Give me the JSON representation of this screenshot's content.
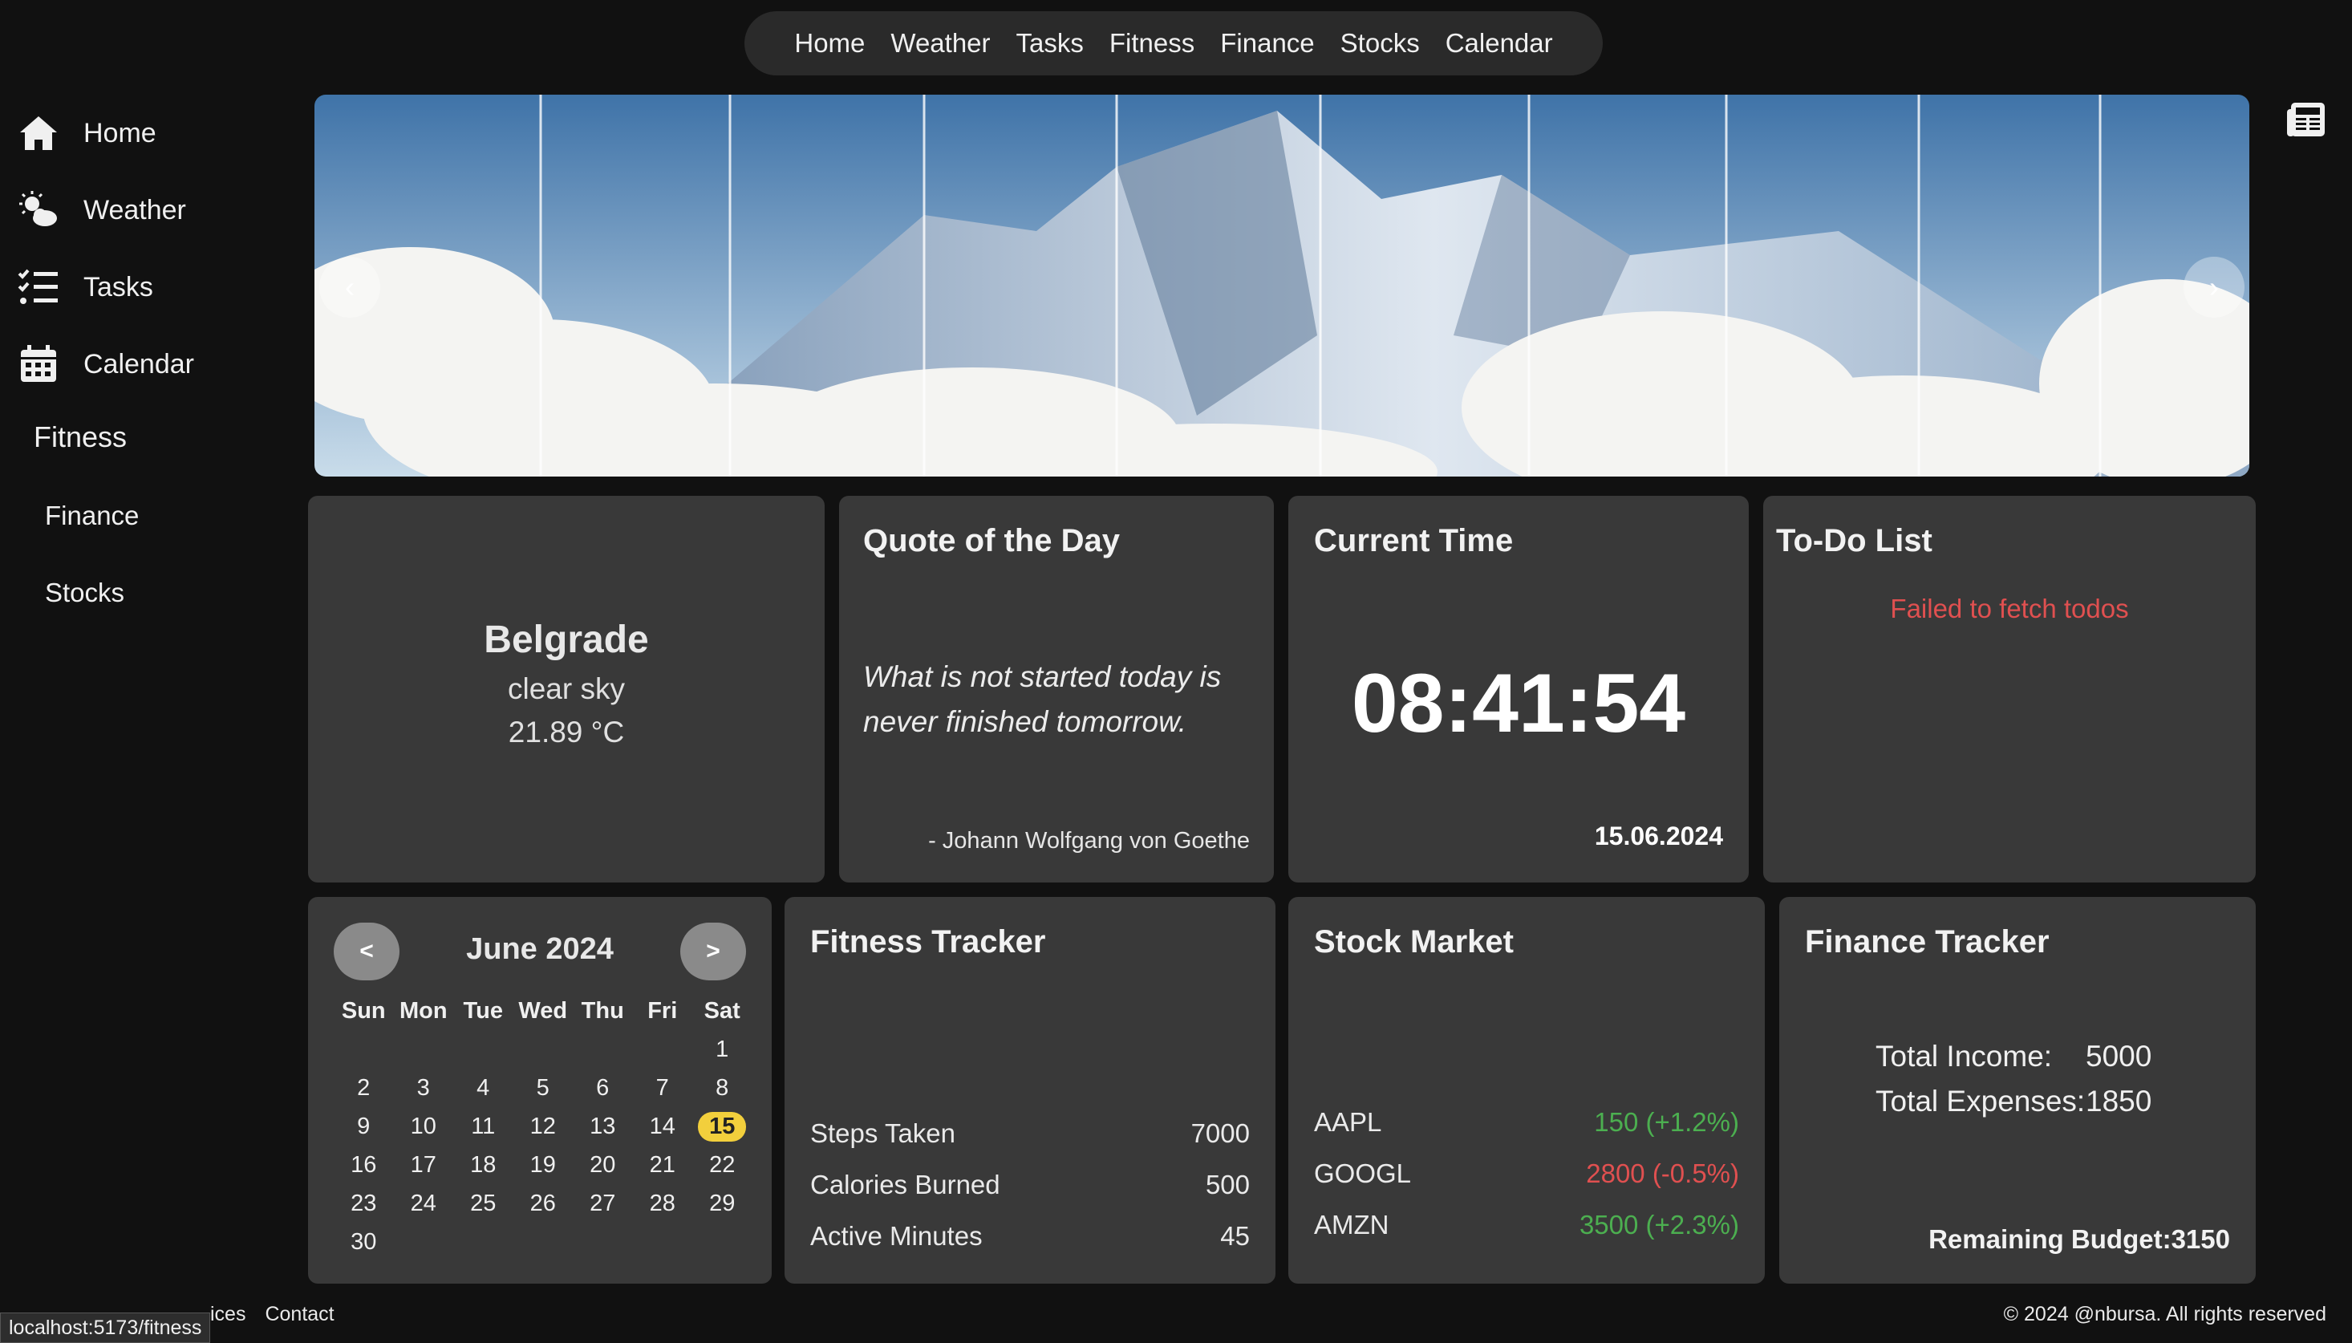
{
  "topnav": [
    "Home",
    "Weather",
    "Tasks",
    "Fitness",
    "Finance",
    "Stocks",
    "Calendar"
  ],
  "sidebar": {
    "items": [
      {
        "label": "Home",
        "icon": "home-icon"
      },
      {
        "label": "Weather",
        "icon": "weather-icon"
      },
      {
        "label": "Tasks",
        "icon": "tasks-icon"
      },
      {
        "label": "Calendar",
        "icon": "calendar-icon"
      },
      {
        "label": "Fitness"
      },
      {
        "label": "Finance"
      },
      {
        "label": "Stocks"
      }
    ]
  },
  "hero": {
    "prev": "‹",
    "next": "›"
  },
  "weather": {
    "city": "Belgrade",
    "description": "clear sky",
    "temperature": "21.89 °C"
  },
  "quote": {
    "title": "Quote of the Day",
    "text": "What is not started today is never finished tomorrow.",
    "author": "- Johann Wolfgang von Goethe"
  },
  "clock": {
    "title": "Current Time",
    "time": "08:41:54",
    "date": "15.06.2024"
  },
  "todo": {
    "title": "To-Do List",
    "error": "Failed to fetch todos"
  },
  "calendar": {
    "prev": "<",
    "next": ">",
    "title": "June 2024",
    "weekdays": [
      "Sun",
      "Mon",
      "Tue",
      "Wed",
      "Thu",
      "Fri",
      "Sat"
    ],
    "weeks": [
      [
        "",
        "",
        "",
        "",
        "",
        "",
        "1"
      ],
      [
        "2",
        "3",
        "4",
        "5",
        "6",
        "7",
        "8"
      ],
      [
        "9",
        "10",
        "11",
        "12",
        "13",
        "14",
        "15"
      ],
      [
        "16",
        "17",
        "18",
        "19",
        "20",
        "21",
        "22"
      ],
      [
        "23",
        "24",
        "25",
        "26",
        "27",
        "28",
        "29"
      ],
      [
        "30",
        "",
        "",
        "",
        "",
        "",
        ""
      ]
    ],
    "today": "15"
  },
  "fitness": {
    "title": "Fitness Tracker",
    "stats": [
      {
        "label": "Steps Taken",
        "value": "7000"
      },
      {
        "label": "Calories Burned",
        "value": "500"
      },
      {
        "label": "Active Minutes",
        "value": "45"
      }
    ]
  },
  "stocks": {
    "title": "Stock Market",
    "items": [
      {
        "symbol": "AAPL",
        "value": "150 (+1.2%)",
        "color": "#4caf50"
      },
      {
        "symbol": "GOOGL",
        "value": "2800 (-0.5%)",
        "color": "#e05050"
      },
      {
        "symbol": "AMZN",
        "value": "3500 (+2.3%)",
        "color": "#4caf50"
      }
    ]
  },
  "finance": {
    "title": "Finance Tracker",
    "income_label": "Total Income:",
    "income": "5000",
    "expenses_label": "Total Expenses:",
    "expenses": "1850",
    "budget": "Remaining Budget:3150"
  },
  "footer": {
    "links": [
      "ices",
      "Contact"
    ],
    "copyright": "© 2024 @nbursa. All rights reserved",
    "status_url": "localhost:5173/fitness"
  }
}
